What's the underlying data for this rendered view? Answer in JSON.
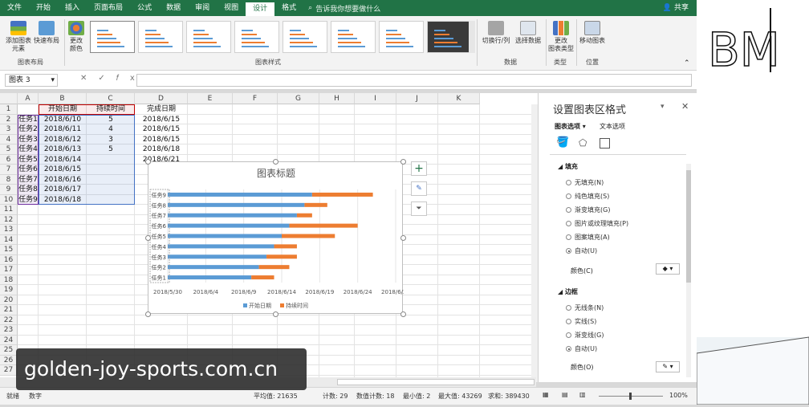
{
  "tabs": [
    "文件",
    "开始",
    "插入",
    "页面布局",
    "公式",
    "数据",
    "审阅",
    "视图",
    "设计",
    "格式"
  ],
  "active_tab": "设计",
  "tell_me": "告诉我你想要做什么",
  "share": "共享",
  "ribbon": {
    "add_element": "添加图表\n元素",
    "quick_layout": "快速布局",
    "change_colors": "更改\n颜色",
    "switch_row_col": "切换行/列",
    "select_data": "选择数据",
    "change_type": "更改\n图表类型",
    "move_chart": "移动图表",
    "groups": {
      "layout": "图表布局",
      "styles": "图表样式",
      "data": "数据",
      "type": "类型",
      "location": "位置"
    }
  },
  "namebox": "图表 3",
  "columns": [
    "A",
    "B",
    "C",
    "D",
    "E",
    "F",
    "G",
    "H",
    "I",
    "J",
    "K"
  ],
  "rows": [
    "1",
    "2",
    "3",
    "4",
    "5",
    "6",
    "7",
    "8",
    "9",
    "10",
    "11",
    "12",
    "13",
    "14",
    "15",
    "16",
    "17",
    "18",
    "19",
    "20",
    "21",
    "22",
    "23",
    "24",
    "25",
    "26",
    "27"
  ],
  "headers": [
    "开始日期",
    "持续时间",
    "完成日期"
  ],
  "table": [
    [
      "任务1",
      "2018/6/10",
      "5",
      "2018/6/15"
    ],
    [
      "任务2",
      "2018/6/11",
      "4",
      "2018/6/15"
    ],
    [
      "任务3",
      "2018/6/12",
      "3",
      "2018/6/15"
    ],
    [
      "任务4",
      "2018/6/13",
      "5",
      "2018/6/18"
    ],
    [
      "任务5",
      "2018/6/14",
      "",
      "2018/6/21"
    ],
    [
      "任务6",
      "2018/6/15",
      "",
      ""
    ],
    [
      "任务7",
      "2018/6/16",
      "",
      ""
    ],
    [
      "任务8",
      "2018/6/17",
      "",
      ""
    ],
    [
      "任务9",
      "2018/6/18",
      "",
      ""
    ]
  ],
  "chart_data": {
    "type": "bar",
    "title": "图表标题",
    "categories": [
      "任务1",
      "任务2",
      "任务3",
      "任务4",
      "任务5",
      "任务6",
      "任务7",
      "任务8",
      "任务9"
    ],
    "x_ticks": [
      "2018/5/30",
      "2018/6/4",
      "2018/6/9",
      "2018/6/14",
      "2018/6/19",
      "2018/6/24",
      "2018/6/29"
    ],
    "x_tick_values": [
      0,
      5,
      10,
      15,
      20,
      25,
      30
    ],
    "series": [
      {
        "name": "开始日期",
        "color": "#5b9bd5",
        "values": [
          11,
          12,
          13,
          14,
          15,
          16,
          17,
          18,
          19
        ]
      },
      {
        "name": "持续时间",
        "color": "#ed7d31",
        "values": [
          3,
          4,
          4,
          3,
          7,
          9,
          2,
          3,
          8
        ]
      }
    ],
    "legend": "bottom"
  },
  "pane": {
    "title": "设置图表区格式",
    "tab1": "图表选项",
    "tab2": "文本选项",
    "fill_section": "填充",
    "fill_options": [
      "无填充(N)",
      "纯色填充(S)",
      "渐变填充(G)",
      "图片或纹理填充(P)",
      "图案填充(A)",
      "自动(U)"
    ],
    "fill_color": "颜色(C)",
    "border_section": "边框",
    "border_options": [
      "无线条(N)",
      "实线(S)",
      "渐变线(G)",
      "自动(U)"
    ],
    "border_color": "颜色(O)"
  },
  "status": {
    "ready": "就绪",
    "mode": "数字",
    "avg": "平均值: 21635",
    "count": "计数: 29",
    "numcount": "数值计数: 18",
    "min": "最小值: 2",
    "max": "最大值: 43269",
    "sum": "求和: 389430",
    "zoom": "100%"
  },
  "watermark": "golden-joy-sports.com.cn",
  "logo": "BM"
}
